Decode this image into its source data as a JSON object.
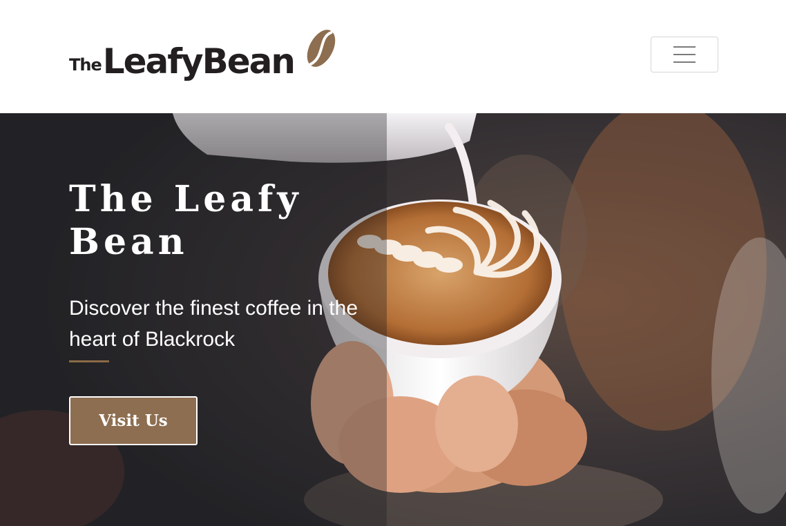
{
  "navbar": {
    "logo": {
      "prefix": "The",
      "name": "LeafyBean",
      "icon": "coffee-bean-icon"
    },
    "menu_toggle": {
      "icon": "hamburger-menu-icon"
    }
  },
  "hero": {
    "title": "The Leafy Bean",
    "subtitle": "Discover the finest coffee in the heart of Blackrock",
    "cta_label": "Visit Us",
    "background": "latte-art-pour-photo"
  },
  "colors": {
    "brand_brown": "#8d6e50",
    "logo_text": "#231f20",
    "hero_overlay": "#2a2a2c",
    "accent_rule": "#8b6b47"
  }
}
